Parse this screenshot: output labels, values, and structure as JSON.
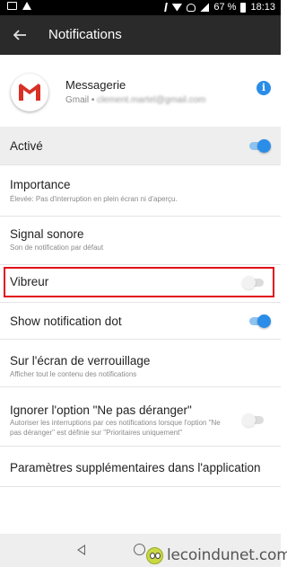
{
  "status_bar": {
    "battery": "67 %",
    "time": "18:13",
    "icons": [
      "image-icon",
      "warning-icon",
      "bluetooth-icon",
      "wifi-icon",
      "mute-icon",
      "signal-icon",
      "battery-icon"
    ]
  },
  "app_bar": {
    "back_icon": "arrow-left-icon",
    "title": "Notifications"
  },
  "app_header": {
    "app_name": "Messagerie",
    "account_prefix": "Gmail • ",
    "account_email": "clement.martel@gmail.com",
    "info_icon": "i"
  },
  "settings": {
    "active": {
      "label": "Activé",
      "on": true
    },
    "importance": {
      "label": "Importance",
      "desc": "Élevée: Pas d'interruption en plein écran ni d'aperçu."
    },
    "sound": {
      "label": "Signal sonore",
      "desc": "Son de notification par défaut"
    },
    "vibrate": {
      "label": "Vibreur",
      "on": false
    },
    "dot": {
      "label": "Show notification dot",
      "on": true
    },
    "lockscreen": {
      "label": "Sur l'écran de verrouillage",
      "desc": "Afficher tout le contenu des notifications"
    },
    "dnd": {
      "label": "Ignorer l'option \"Ne pas déranger\"",
      "desc": "Autoriser les interruptions par ces notifications lorsque l'option \"Ne pas déranger\" est définie sur \"Prioritaires uniquement\"",
      "on": false
    },
    "extra": {
      "label": "Paramètres supplémentaires dans l'application"
    }
  },
  "highlight_color": "#e1111a",
  "accent_color": "#2a8de8",
  "watermark": "lecoindunet.com"
}
